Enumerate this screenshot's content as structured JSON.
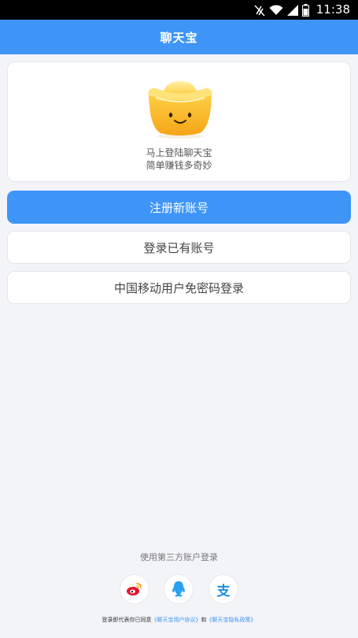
{
  "status_bar": {
    "time": "11:38"
  },
  "header": {
    "title": "聊天宝"
  },
  "hero": {
    "line1": "马上登陆聊天宝",
    "line2": "简单赚钱多奇妙"
  },
  "buttons": {
    "register": "注册新账号",
    "login": "登录已有账号",
    "china_mobile": "中国移动用户免密码登录"
  },
  "third_party": {
    "title": "使用第三方账户登录",
    "providers": [
      "weibo",
      "qq",
      "alipay"
    ],
    "alipay_glyph": "支"
  },
  "agreement": {
    "prefix": "登录即代表你已同意",
    "user_agreement": "《聊天宝用户协议》",
    "and": "和",
    "privacy_policy": "《聊天宝隐私政策》"
  },
  "colors": {
    "brand_blue": "#3e95f7",
    "background": "#f3f4f8"
  }
}
